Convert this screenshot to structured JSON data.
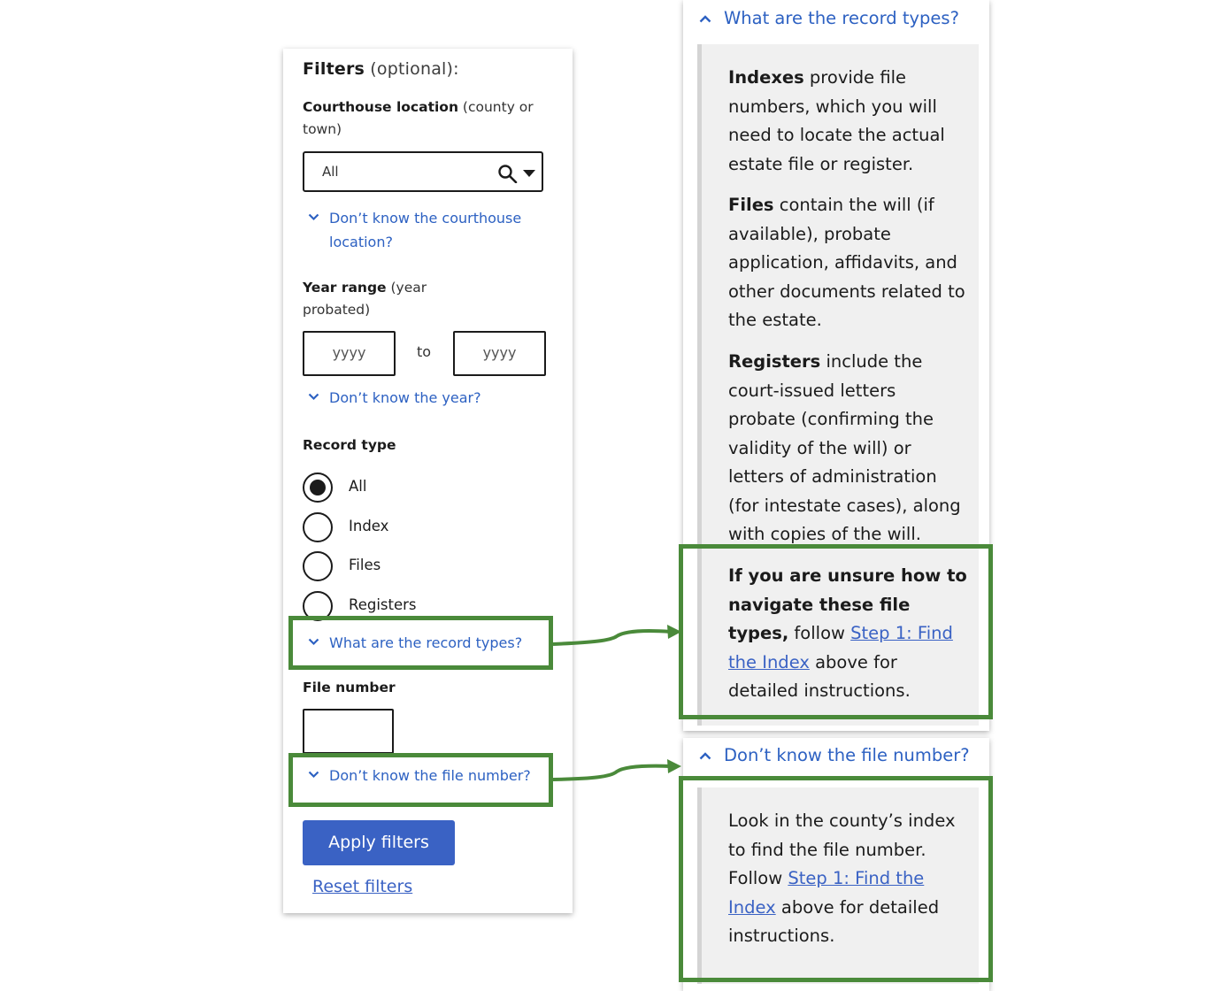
{
  "filters": {
    "title_bold": "Filters",
    "title_rest": " (optional):",
    "courthouse": {
      "label_bold": "Courthouse location",
      "label_rest": " (county or town)",
      "value": "All",
      "help": "Don’t know the courthouse location?"
    },
    "year": {
      "label_bold": "Year range",
      "label_rest": " (year probated)",
      "from_placeholder": "yyyy",
      "to_text": "to",
      "to_placeholder": "yyyy",
      "help": "Don’t know the year?"
    },
    "record_type": {
      "label": "Record type",
      "options": [
        {
          "label": "All",
          "selected": true
        },
        {
          "label": "Index",
          "selected": false
        },
        {
          "label": "Files",
          "selected": false
        },
        {
          "label": "Registers",
          "selected": false
        }
      ],
      "help": "What are the record types?"
    },
    "file_number": {
      "label": "File number",
      "help": "Don’t know the file number?"
    },
    "apply_label": "Apply filters",
    "reset_label": "Reset filters"
  },
  "record_types_panel": {
    "heading": "What are the record types?",
    "indexes_bold": "Indexes",
    "indexes_text": " provide file numbers, which you will need to locate the actual estate file or register.",
    "files_bold": "Files",
    "files_text": " contain the will (if available), probate application, affidavits, and other documents related to the estate.",
    "registers_bold": "Registers",
    "registers_text": " include the court-issued letters probate (confirming the validity of the will) or letters of administration (for intestate cases), along with copies of the will.",
    "unsure_bold": "If you are unsure how to navigate these file types,",
    "unsure_pre": " follow ",
    "unsure_link": "Step 1: Find the Index",
    "unsure_post": " above for detailed instructions."
  },
  "file_number_panel": {
    "heading": "Don’t know the file number?",
    "text_pre": "Look in the county’s index to find the file number. Follow ",
    "link": "Step 1: Find the Index",
    "text_post": " above for detailed instructions."
  },
  "colors": {
    "accent_blue": "#3a62c4",
    "link_blue": "#2d61c2",
    "callout_green": "#4a8a3a",
    "panel_gray": "#f0f0f0"
  }
}
